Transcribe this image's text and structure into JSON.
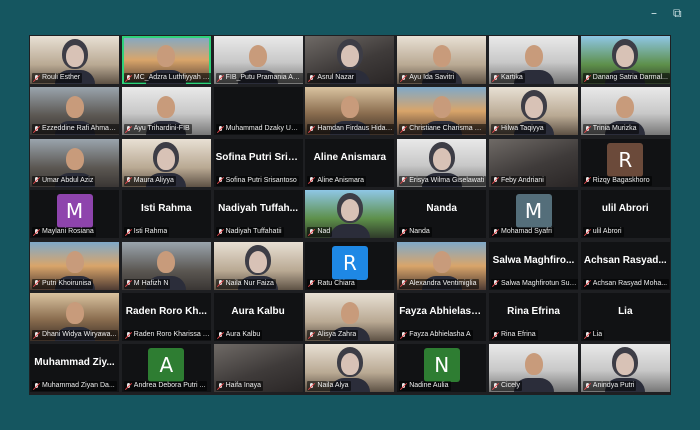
{
  "window": {
    "minimize_glyph": "–",
    "restore_glyph": "⧉"
  },
  "accent": "#2fd27a",
  "participants": [
    {
      "name": "Rouli Esther",
      "big": "",
      "avatar": "",
      "style": "photo alt3"
    },
    {
      "name": "MC_Adzra Luthfiyyah Hau...",
      "big": "",
      "avatar": "",
      "style": "photo alt4 active"
    },
    {
      "name": "FIB_Putu Pramania Ad...",
      "big": "",
      "avatar": "",
      "style": "photo alt6"
    },
    {
      "name": "Asrul Nazar",
      "big": "",
      "avatar": "",
      "style": "photo"
    },
    {
      "name": "Ayu Ida Savitri",
      "big": "",
      "avatar": "",
      "style": "photo alt3"
    },
    {
      "name": "Kartika",
      "big": "",
      "avatar": "",
      "style": "photo alt6"
    },
    {
      "name": "Danang Satria Darmal...",
      "big": "",
      "avatar": "",
      "style": "photo alt5"
    },
    {
      "name": "Ezzeddine Rafi Ahmad...",
      "big": "",
      "avatar": "",
      "style": "photo alt1"
    },
    {
      "name": "Ayu Trihardini-FIB",
      "big": "",
      "avatar": "",
      "style": "photo alt6"
    },
    {
      "name": "Muhammad Dzaky Um...",
      "big": "",
      "avatar": "",
      "style": "plain"
    },
    {
      "name": "Hamdan Firdaus Hiday...",
      "big": "",
      "avatar": "",
      "style": "photo alt2"
    },
    {
      "name": "Christiane Charisma N...",
      "big": "",
      "avatar": "",
      "style": "photo alt4"
    },
    {
      "name": "Hilwa Taqiyya",
      "big": "",
      "avatar": "",
      "style": "photo alt3"
    },
    {
      "name": "Trinia Murizka",
      "big": "",
      "avatar": "",
      "style": "photo alt6"
    },
    {
      "name": "Umar Abdul Aziz",
      "big": "",
      "avatar": "",
      "style": "photo alt1"
    },
    {
      "name": "Maura Aliyya",
      "big": "",
      "avatar": "",
      "style": "photo alt3"
    },
    {
      "name": "Sofina Putri Srisantoso",
      "big": "Sofina Putri Srisa...",
      "avatar": "",
      "style": "plain"
    },
    {
      "name": "Aline Anismara",
      "big": "Aline Anismara",
      "avatar": "",
      "style": "plain"
    },
    {
      "name": "Erisya Wilma Giselawati",
      "big": "",
      "avatar": "",
      "style": "photo alt6"
    },
    {
      "name": "Feby Andriani",
      "big": "",
      "avatar": "",
      "style": "photo dark"
    },
    {
      "name": "Rizqy Bagaskhoro",
      "big": "",
      "avatar": "R",
      "style": "avatar",
      "color": "#6b4a3a"
    },
    {
      "name": "Maylani Rosiana",
      "big": "",
      "avatar": "M",
      "style": "avatar",
      "color": "#8e44ad"
    },
    {
      "name": "Isti Rahma",
      "big": "Isti Rahma",
      "avatar": "",
      "style": "plain"
    },
    {
      "name": "Nadiyah Tuffahatii",
      "big": "Nadiyah Tuffah...",
      "avatar": "",
      "style": "plain"
    },
    {
      "name": "Nad",
      "big": "",
      "avatar": "",
      "style": "photo alt5"
    },
    {
      "name": "Nanda",
      "big": "Nanda",
      "avatar": "",
      "style": "plain"
    },
    {
      "name": "Mohamad Syafri",
      "big": "",
      "avatar": "M",
      "style": "avatar",
      "color": "#546e7a"
    },
    {
      "name": "ulil Abrori",
      "big": "ulil Abrori",
      "avatar": "",
      "style": "plain"
    },
    {
      "name": "Putri Khoirunisa",
      "big": "",
      "avatar": "",
      "style": "photo alt4"
    },
    {
      "name": "M Hafizh N",
      "big": "",
      "avatar": "",
      "style": "photo alt1"
    },
    {
      "name": "Naila Nur Faiza",
      "big": "",
      "avatar": "",
      "style": "photo alt3"
    },
    {
      "name": "Ratu Chiara",
      "big": "",
      "avatar": "R",
      "style": "avatar",
      "color": "#1e88e5"
    },
    {
      "name": "Alexandra Ventimiglia",
      "big": "",
      "avatar": "",
      "style": "photo alt4"
    },
    {
      "name": "Salwa Maghfirotun Sulfi...",
      "big": "Salwa Maghfiro...",
      "avatar": "",
      "style": "plain"
    },
    {
      "name": "Achsan Rasyad Moha...",
      "big": "Achsan Rasyad...",
      "avatar": "",
      "style": "plain"
    },
    {
      "name": "Dhani Widya Wiryawa...",
      "big": "",
      "avatar": "",
      "style": "photo alt2"
    },
    {
      "name": "Raden Roro Kharissa P...",
      "big": "Raden Roro Kh...",
      "avatar": "",
      "style": "plain"
    },
    {
      "name": "Aura Kalbu",
      "big": "Aura Kalbu",
      "avatar": "",
      "style": "plain"
    },
    {
      "name": "Alisya Zahra",
      "big": "",
      "avatar": "",
      "style": "photo alt3"
    },
    {
      "name": "Fayza Abhielasha A",
      "big": "Fayza Abhielash...",
      "avatar": "",
      "style": "plain"
    },
    {
      "name": "Rina Efrina",
      "big": "Rina Efrina",
      "avatar": "",
      "style": "plain"
    },
    {
      "name": "Lia",
      "big": "Lia",
      "avatar": "",
      "style": "plain"
    },
    {
      "name": "Muhammad Ziyan Da...",
      "big": "Muhammad Ziy...",
      "avatar": "",
      "style": "plain"
    },
    {
      "name": "Andrea Debora Putri ...",
      "big": "",
      "avatar": "A",
      "style": "avatar",
      "color": "#2e7d32"
    },
    {
      "name": "Haifa Inaya",
      "big": "",
      "avatar": "",
      "style": "photo dark"
    },
    {
      "name": "Naila Alya",
      "big": "",
      "avatar": "",
      "style": "photo alt3"
    },
    {
      "name": "Nadine Aulia",
      "big": "",
      "avatar": "N",
      "style": "avatar",
      "color": "#2e7d32"
    },
    {
      "name": "Cicely",
      "big": "",
      "avatar": "",
      "style": "photo alt6"
    },
    {
      "name": "Anindya Putri",
      "big": "",
      "avatar": "",
      "style": "photo alt6"
    }
  ]
}
